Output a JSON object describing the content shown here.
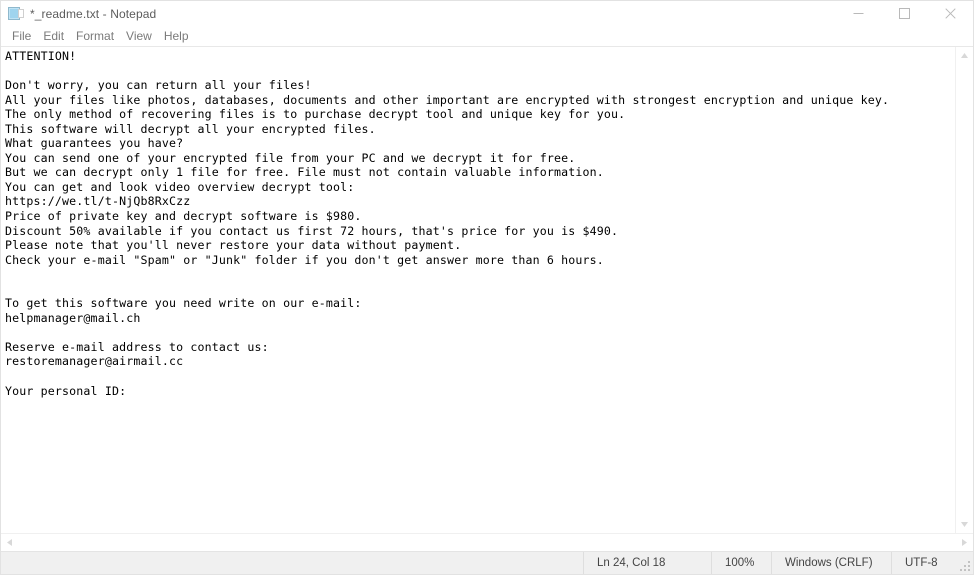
{
  "window": {
    "title": "*_readme.txt - Notepad",
    "icon": "notepad-document-icon",
    "controls": {
      "minimize": "Minimize",
      "maximize": "Maximize",
      "close": "Close"
    }
  },
  "menubar": {
    "items": [
      {
        "label": "File"
      },
      {
        "label": "Edit"
      },
      {
        "label": "Format"
      },
      {
        "label": "View"
      },
      {
        "label": "Help"
      }
    ]
  },
  "editor": {
    "lines": [
      "ATTENTION!",
      "",
      "Don't worry, you can return all your files!",
      "All your files like photos, databases, documents and other important are encrypted with strongest encryption and unique key.",
      "The only method of recovering files is to purchase decrypt tool and unique key for you.",
      "This software will decrypt all your encrypted files.",
      "What guarantees you have?",
      "You can send one of your encrypted file from your PC and we decrypt it for free.",
      "But we can decrypt only 1 file for free. File must not contain valuable information.",
      "You can get and look video overview decrypt tool:",
      "https://we.tl/t-NjQb8RxCzz",
      "Price of private key and decrypt software is $980.",
      "Discount 50% available if you contact us first 72 hours, that's price for you is $490.",
      "Please note that you'll never restore your data without payment.",
      "Check your e-mail \"Spam\" or \"Junk\" folder if you don't get answer more than 6 hours.",
      "",
      "",
      "To get this software you need write on our e-mail:",
      "helpmanager@mail.ch",
      "",
      "Reserve e-mail address to contact us:",
      "restoremanager@airmail.cc",
      "",
      "Your personal ID:"
    ]
  },
  "scrollbars": {
    "vertical_up": "scroll-up-arrow",
    "vertical_down": "scroll-down-arrow",
    "horizontal_left": "scroll-left-arrow",
    "horizontal_right": "scroll-right-arrow"
  },
  "statusbar": {
    "cursor_position": "Ln 24, Col 18",
    "zoom": "100%",
    "line_ending": "Windows (CRLF)",
    "encoding": "UTF-8"
  }
}
